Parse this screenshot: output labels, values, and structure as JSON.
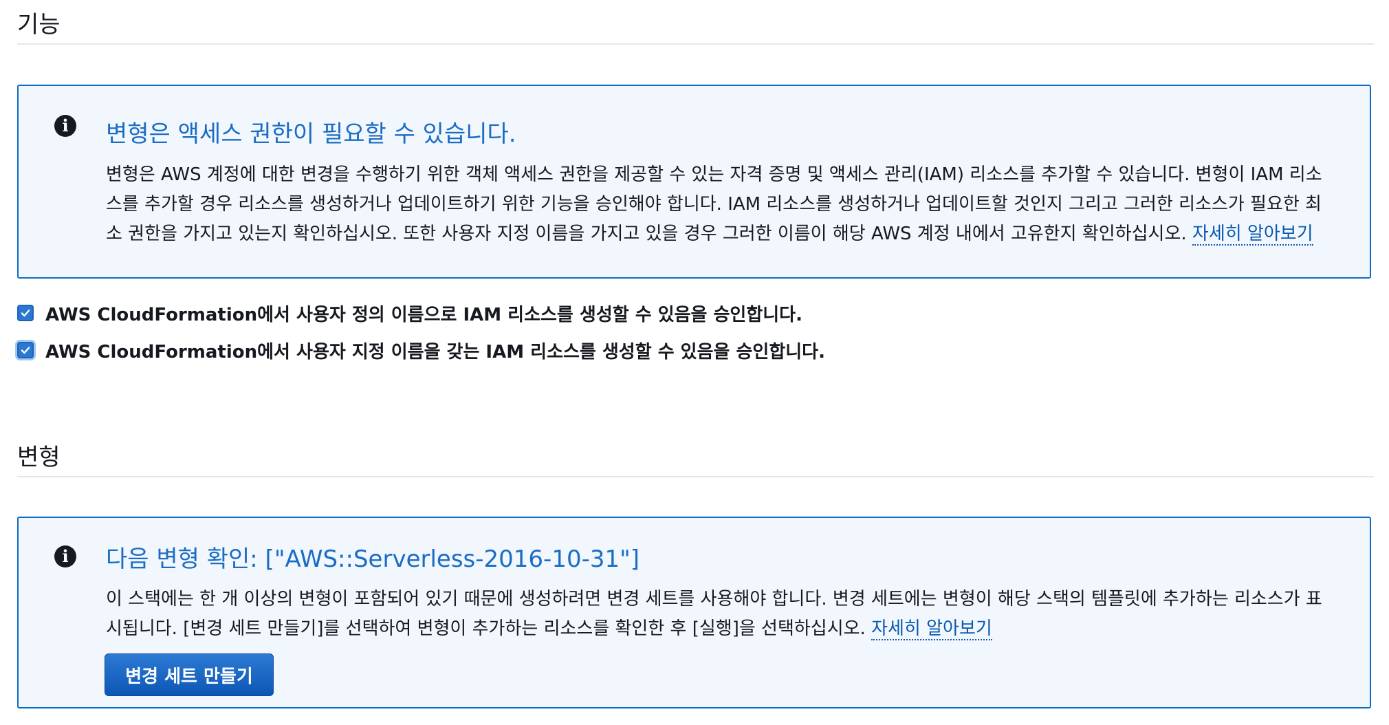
{
  "capabilities": {
    "section_title": "기능",
    "info": {
      "title": "변형은 액세스 권한이 필요할 수 있습니다.",
      "body_line1": "변형은 AWS 계정에 대한 변경을 수행하기 위한 객체 액세스 권한을 제공할 수 있는 자격 증명 및 액세스 관리(IAM) 리소스를 추가할 수 있습니다. 변형이 IAM 리소",
      "body_line2": "스를 추가할 경우 리소스를 생성하거나 업데이트하기 위한 기능을 승인해야 합니다. IAM 리소스를 생성하거나 업데이트할 것인지 그리고 그러한 리소스가 필요한 최",
      "body_line3": "소 권한을 가지고 있는지 확인하십시오. 또한 사용자 지정 이름을 가지고 있을 경우 그러한 이름이 해당 AWS 계정 내에서 고유한지 확인하십시오.",
      "link": "자세히 알아보기"
    },
    "checkboxes": [
      {
        "label": "AWS CloudFormation에서 사용자 정의 이름으로 IAM 리소스를 생성할 수 있음을 승인합니다.",
        "checked": true
      },
      {
        "label": "AWS CloudFormation에서 사용자 지정 이름을 갖는 IAM 리소스를 생성할 수 있음을 승인합니다.",
        "checked": true
      }
    ]
  },
  "transforms": {
    "section_title": "변형",
    "info": {
      "title": "다음 변형 확인: [\"AWS::Serverless-2016-10-31\"]",
      "body_line1": "이 스택에는 한 개 이상의 변형이 포함되어 있기 때문에 생성하려면 변경 세트를 사용해야 합니다. 변경 세트에는 변형이 해당 스택의 템플릿에 추가하는 리소스가 표",
      "body_line2": "시됩니다. [변경 세트 만들기]를 선택하여 변형이 추가하는 리소스를 확인한 후 [실행]을 선택하십시오.",
      "link": "자세히 알아보기"
    },
    "button_label": "변경 세트 만들기"
  },
  "colors": {
    "accent": "#0d6dc4",
    "info_background": "#f1f7fd",
    "primary_button": "#0d61c1",
    "link": "#0a58b0"
  },
  "icons": {
    "info": "info-circle-icon",
    "check": "checkmark-icon"
  }
}
